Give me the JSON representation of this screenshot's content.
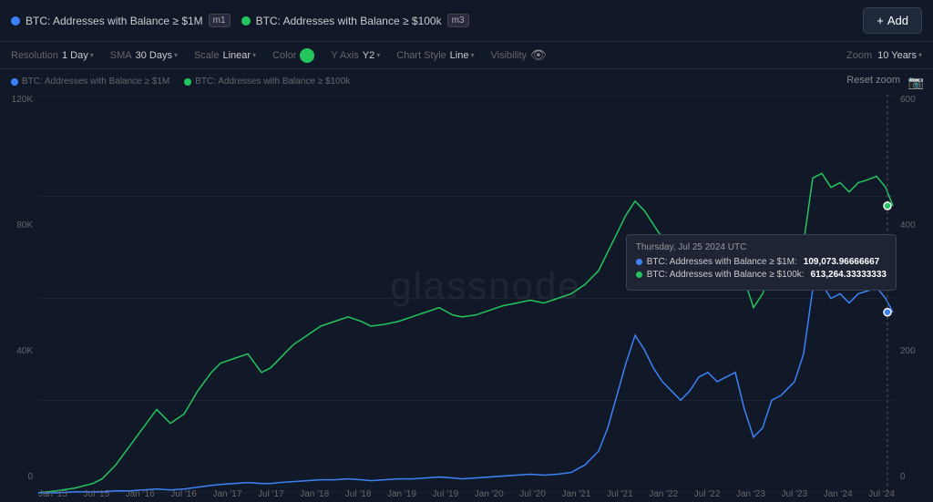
{
  "header": {
    "series1": {
      "label": "BTC: Addresses with Balance ≥ $1M",
      "badge": "m1",
      "color": "#3b82f6"
    },
    "series2": {
      "label": "BTC: Addresses with Balance ≥ $100k",
      "badge": "m3",
      "color": "#22c55e"
    },
    "add_button": "+ Add"
  },
  "controls": {
    "resolution_label": "Resolution",
    "resolution_value": "1 Day",
    "sma_label": "SMA",
    "sma_value": "30 Days",
    "scale_label": "Scale",
    "scale_value": "Linear",
    "color_label": "Color",
    "yaxis_label": "Y Axis",
    "yaxis_value": "Y2",
    "chart_style_label": "Chart Style",
    "chart_style_value": "Line",
    "visibility_label": "Visibility",
    "zoom_label": "Zoom",
    "zoom_value": "10 Years"
  },
  "chart": {
    "reset_zoom": "Reset zoom",
    "watermark": "glassnode",
    "subtitle_series1": "BTC: Addresses with Balance ≥ $1M",
    "subtitle_series2": "BTC: Addresses with Balance ≥ $100k",
    "y_axis_left": [
      "120K",
      "80K",
      "40K",
      "0"
    ],
    "y_axis_right": [
      "600",
      "400",
      "200",
      "0"
    ],
    "x_axis": [
      "Jan '15",
      "Jul '15",
      "Jan '16",
      "Jul '16",
      "Jan '17",
      "Jul '17",
      "Jan '18",
      "Jul '18",
      "Jan '19",
      "Jul '19",
      "Jan '20",
      "Jul '20",
      "Jan '21",
      "Jul '21",
      "Jan '22",
      "Jul '22",
      "Jan '23",
      "Jul '23",
      "Jan '24",
      "Jul '24"
    ]
  },
  "tooltip": {
    "date": "Thursday, Jul 25 2024 UTC",
    "row1_label": "BTC: Addresses with Balance ≥ $1M:",
    "row1_value": "109,073.96666667",
    "row2_label": "BTC: Addresses with Balance ≥ $100k:",
    "row2_value": "613,264.33333333",
    "color1": "#3b82f6",
    "color2": "#22c55e"
  }
}
